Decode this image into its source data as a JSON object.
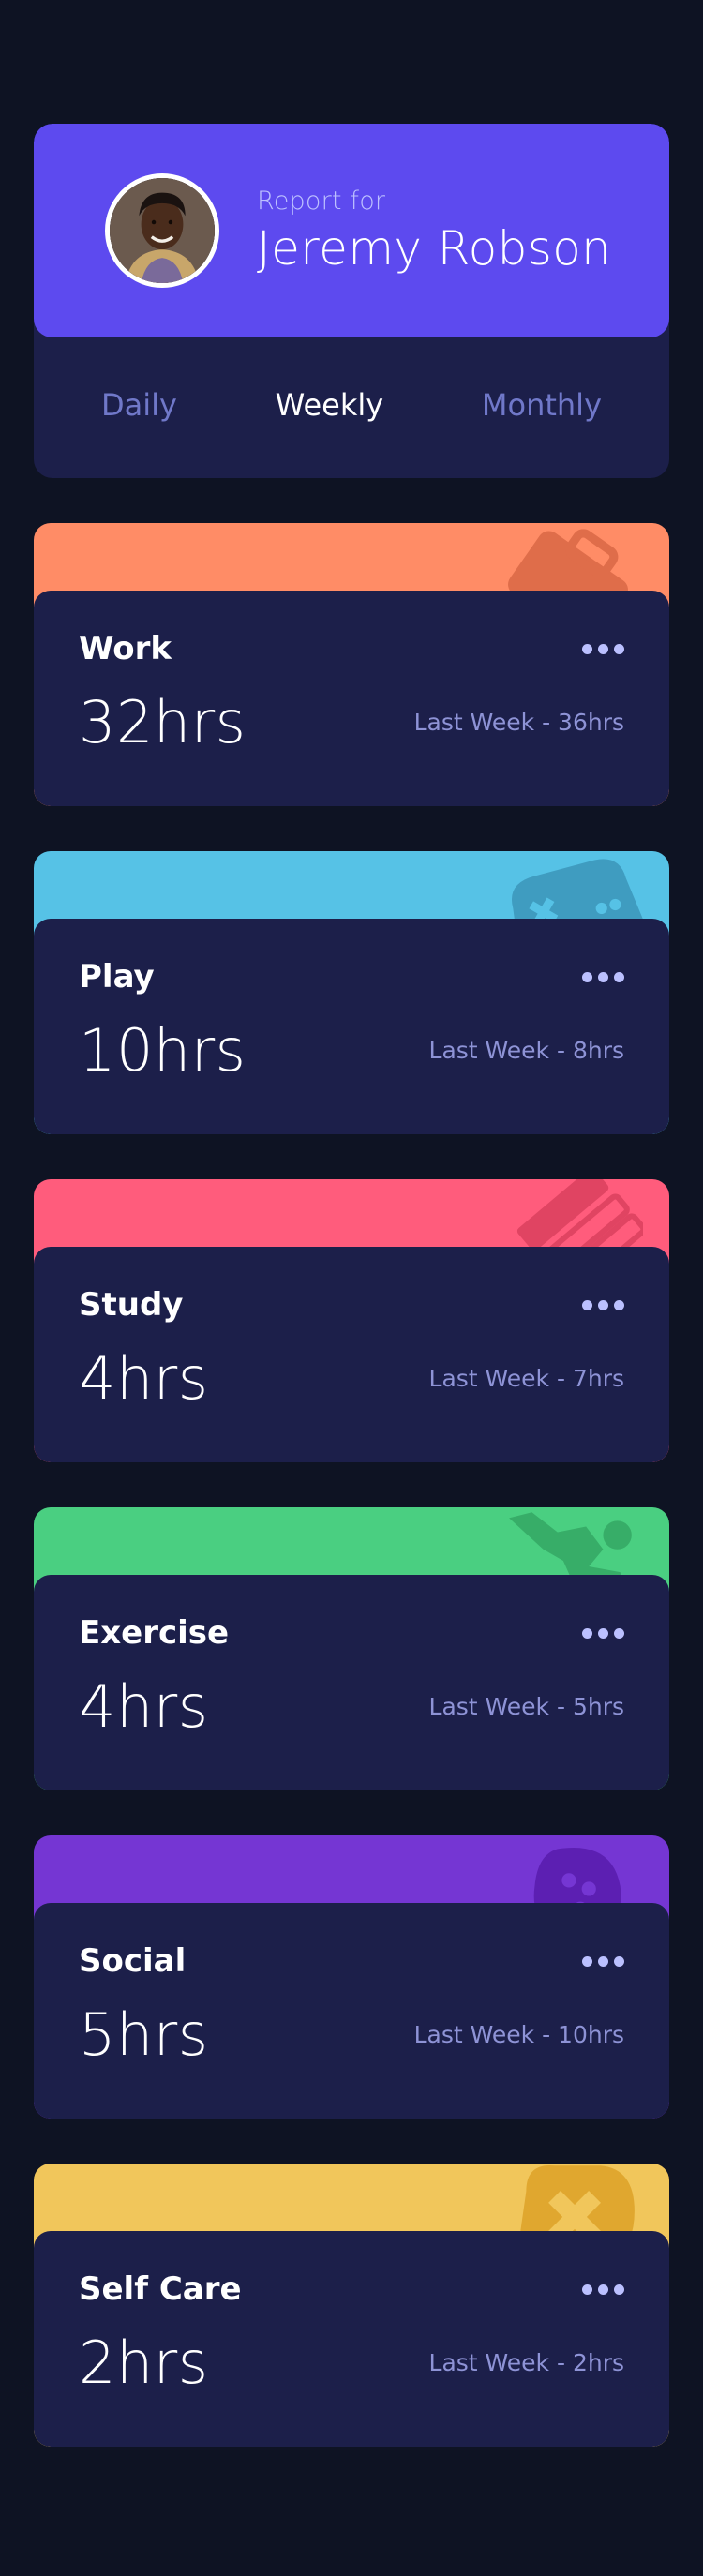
{
  "profile": {
    "report_label": "Report for",
    "name": "Jeremy Robson",
    "avatar": "user-avatar-photo"
  },
  "periods": [
    {
      "label": "Daily",
      "active": false
    },
    {
      "label": "Weekly",
      "active": true
    },
    {
      "label": "Monthly",
      "active": false
    }
  ],
  "activities": [
    {
      "title": "Work",
      "current": "32hrs",
      "previous": "Last Week - 36hrs",
      "color": "#ff8c66",
      "icon": "briefcase-icon"
    },
    {
      "title": "Play",
      "current": "10hrs",
      "previous": "Last Week - 8hrs",
      "color": "#56c2e6",
      "icon": "gamepad-icon"
    },
    {
      "title": "Study",
      "current": "4hrs",
      "previous": "Last Week - 7hrs",
      "color": "#ff5c7c",
      "icon": "book-icon"
    },
    {
      "title": "Exercise",
      "current": "4hrs",
      "previous": "Last Week - 5hrs",
      "color": "#4acf81",
      "icon": "running-person-icon"
    },
    {
      "title": "Social",
      "current": "5hrs",
      "previous": "Last Week - 10hrs",
      "color": "#7536d3",
      "icon": "chat-bubble-icon"
    },
    {
      "title": "Self Care",
      "current": "2hrs",
      "previous": "Last Week - 2hrs",
      "color": "#f1c65b",
      "icon": "heart-icon"
    }
  ],
  "colors": {
    "background": "#0e1323",
    "card": "#1c1f4a",
    "profile_accent": "#5d4aef",
    "muted_text": "#7078c9"
  }
}
